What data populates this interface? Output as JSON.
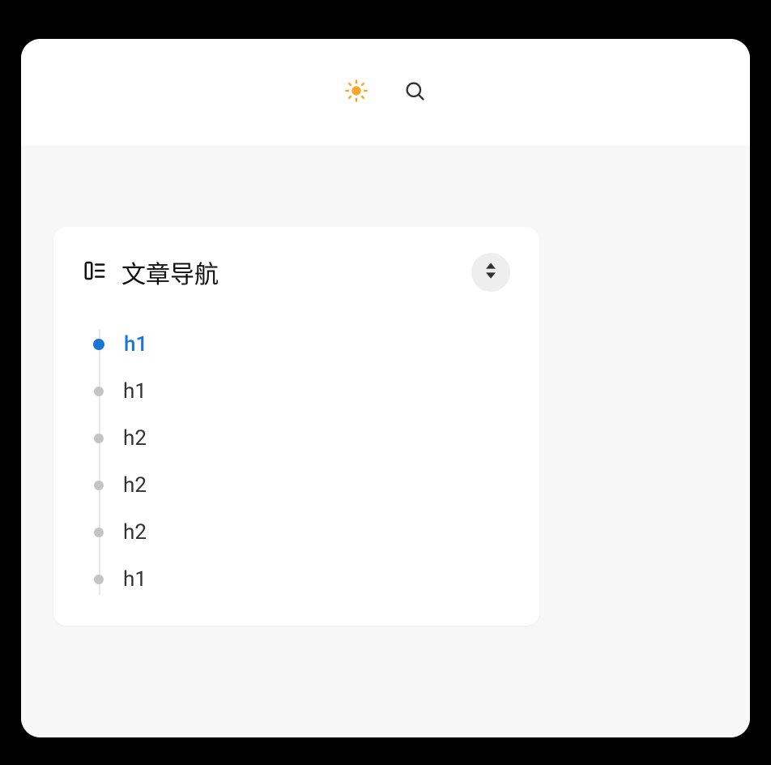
{
  "nav": {
    "title": "文章导航",
    "items": [
      {
        "label": "h1",
        "active": true
      },
      {
        "label": "h1",
        "active": false
      },
      {
        "label": "h2",
        "active": false
      },
      {
        "label": "h2",
        "active": false
      },
      {
        "label": "h2",
        "active": false
      },
      {
        "label": "h1",
        "active": false
      }
    ]
  }
}
